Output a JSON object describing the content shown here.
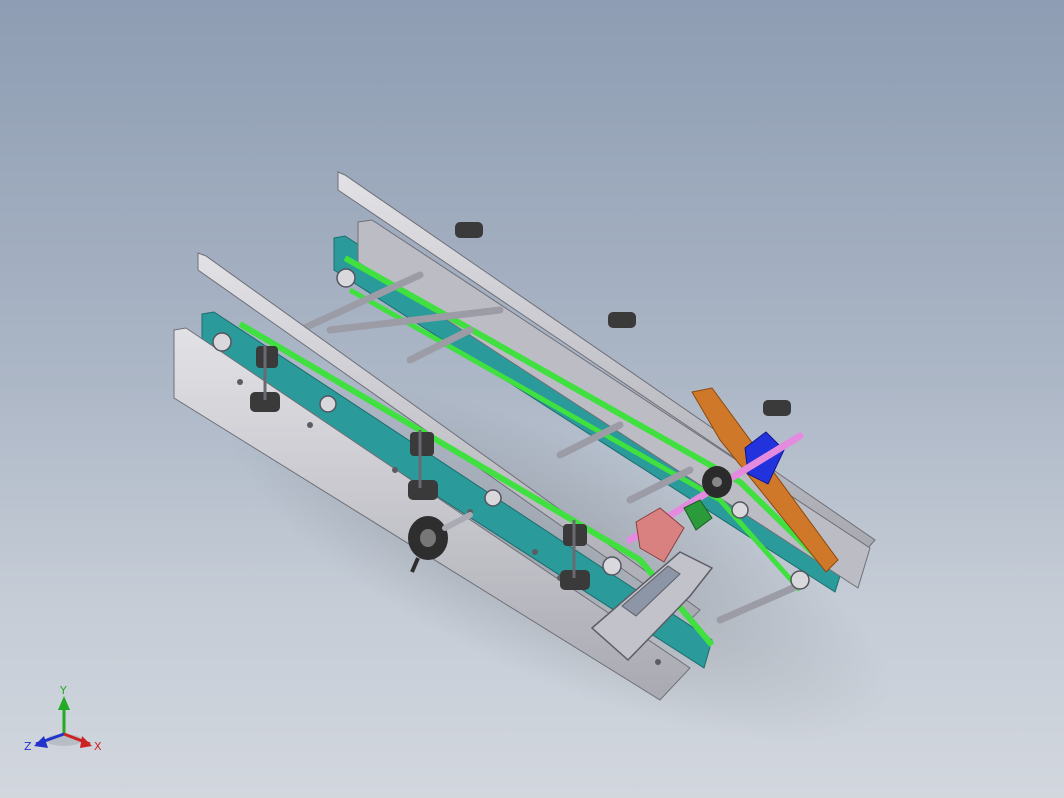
{
  "view": {
    "background_top": "#8e9db3",
    "background_bottom": "#d2d7de",
    "model": "belt-conveyor-assembly"
  },
  "colors": {
    "rail": "#c9c9cf",
    "rail_dark": "#8f8f98",
    "belt_plate": "#2a9a9a",
    "belt": "#3fe03f",
    "shaft": "#c7c7d0",
    "clamp": "#3a3a3a",
    "orange_arm": "#d0782a",
    "blue_block": "#2233dd",
    "pink_shaft": "#e48be0",
    "salmon_block": "#d98080",
    "green_bracket": "#2a9a3a"
  },
  "triad": {
    "y_label": "Y",
    "z_label": "Z",
    "x_label": "X",
    "y_color": "#22aa22",
    "z_color": "#2233cc",
    "x_color": "#cc2222"
  }
}
